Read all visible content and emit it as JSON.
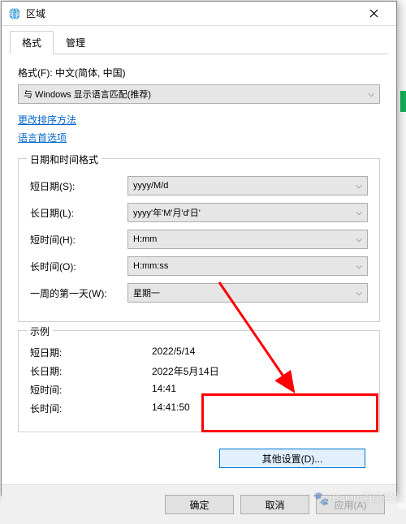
{
  "titlebar": {
    "title": "区域"
  },
  "tabs": [
    {
      "label": "格式",
      "active": true
    },
    {
      "label": "管理",
      "active": false
    }
  ],
  "format": {
    "label": "格式(F): 中文(简体, 中国)",
    "selected": "与 Windows 显示语言匹配(推荐)"
  },
  "links": {
    "sort": "更改排序方法",
    "lang": "语言首选项"
  },
  "dt_group": {
    "legend": "日期和时间格式",
    "rows": [
      {
        "label": "短日期(S):",
        "value": "yyyy/M/d"
      },
      {
        "label": "长日期(L):",
        "value": "yyyy'年'M'月'd'日'"
      },
      {
        "label": "短时间(H):",
        "value": "H:mm"
      },
      {
        "label": "长时间(O):",
        "value": "H:mm:ss"
      },
      {
        "label": "一周的第一天(W):",
        "value": "星期一"
      }
    ]
  },
  "examples": {
    "legend": "示例",
    "rows": [
      {
        "label": "短日期:",
        "value": "2022/5/14"
      },
      {
        "label": "长日期:",
        "value": "2022年5月14日"
      },
      {
        "label": "短时间:",
        "value": "14:41"
      },
      {
        "label": "长时间:",
        "value": "14:41:50"
      }
    ]
  },
  "buttons": {
    "other": "其他设置(D)...",
    "ok": "确定",
    "cancel": "取消",
    "apply": "应用(A)"
  },
  "watermark": "Baidu 百度经验"
}
